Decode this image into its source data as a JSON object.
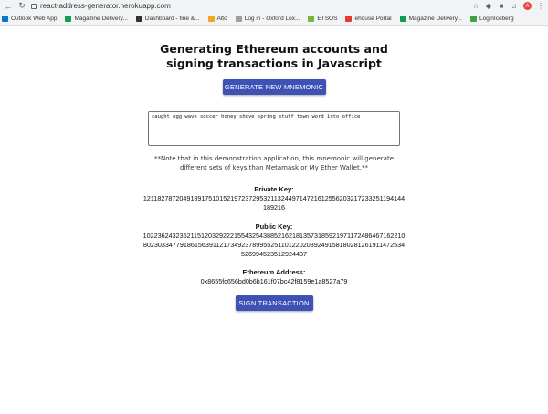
{
  "browser": {
    "url": "react-address-generator.herokuapp.com",
    "avatar_letter": "A",
    "bookmarks": [
      {
        "label": "Outlook Web App",
        "color": "#0078d4"
      },
      {
        "label": "Magazine Delivery...",
        "color": "#0f9d58"
      },
      {
        "label": "Dashboard - fine &...",
        "color": "#333333"
      },
      {
        "label": "Alto",
        "color": "#f4a623"
      },
      {
        "label": "Log in - Oxford Lux...",
        "color": "#9e9e9e"
      },
      {
        "label": "ETSOS",
        "color": "#7cb342"
      },
      {
        "label": "ehouse Portal",
        "color": "#e53935"
      },
      {
        "label": "Magazine Delivery...",
        "color": "#0f9d58"
      },
      {
        "label": "LoginIceberg",
        "color": "#43a047"
      }
    ]
  },
  "page": {
    "title": "Generating Ethereum accounts and signing transactions in Javascript",
    "generate_button": "GENERATE NEW MNEMONIC",
    "mnemonic": "caught egg wave soccer honey shove spring stuff town word into office",
    "note": "**Note that in this demonstration application, this mnemonic will generate different sets of keys than Metamask or My Ether Wallet.**",
    "private_key_label": "Private Key:",
    "private_key": "121182787204918917510152197237295321132449714721612556203217233251194144189216",
    "public_key_label": "Public Key:",
    "public_key": "102236243235211512032922215543254388521621813573185921971172486467162210802303347791861563911217349237899552511012202039249158180281261911472534526994523512924437",
    "address_label": "Ethereum Address:",
    "address": "0x8655fc656bd0b6b161f07bc42f8159e1a8527a79",
    "sign_button": "SIGN TRANSACTION"
  },
  "colors": {
    "button": "#3f51b5"
  }
}
